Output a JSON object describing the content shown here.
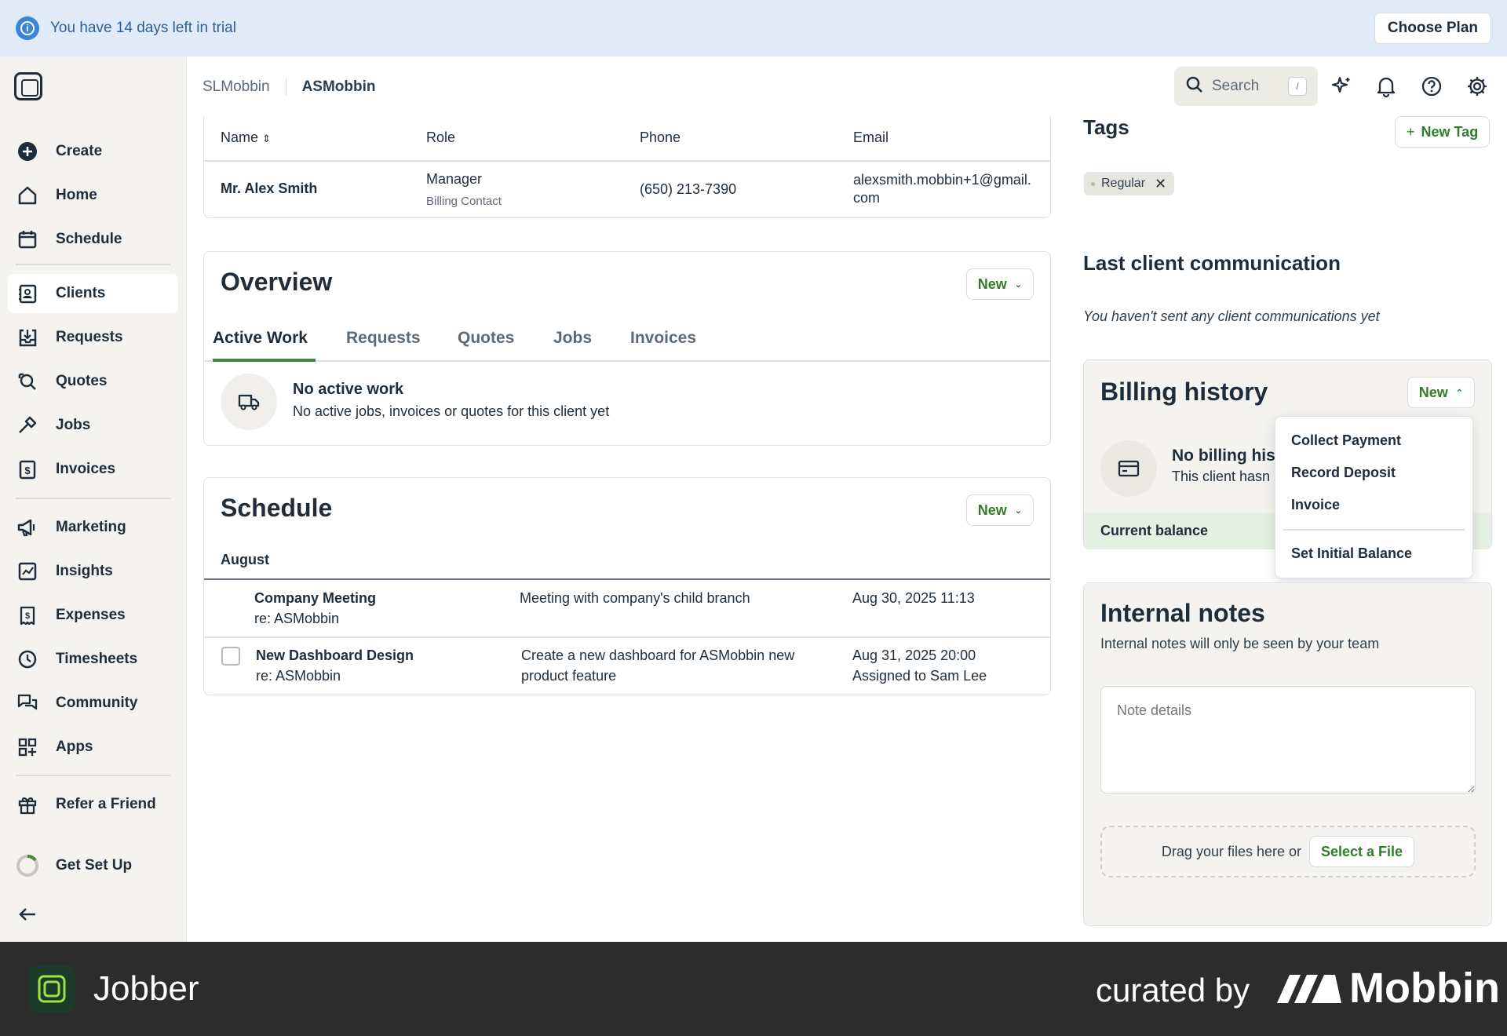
{
  "banner": {
    "text": "You have 14 days left in trial",
    "choose_plan": "Choose Plan"
  },
  "sidebar": {
    "items": [
      {
        "label": "Create"
      },
      {
        "label": "Home"
      },
      {
        "label": "Schedule"
      },
      {
        "label": "Clients"
      },
      {
        "label": "Requests"
      },
      {
        "label": "Quotes"
      },
      {
        "label": "Jobs"
      },
      {
        "label": "Invoices"
      },
      {
        "label": "Marketing"
      },
      {
        "label": "Insights"
      },
      {
        "label": "Expenses"
      },
      {
        "label": "Timesheets"
      },
      {
        "label": "Community"
      },
      {
        "label": "Apps"
      },
      {
        "label": "Refer a Friend"
      },
      {
        "label": "Get Set Up"
      }
    ]
  },
  "header": {
    "breadcrumb": [
      "SLMobbin",
      "ASMobbin"
    ],
    "search_placeholder": "Search",
    "search_shortcut": "/"
  },
  "contacts": {
    "columns": [
      "Name",
      "Role",
      "Phone",
      "Email"
    ],
    "row": {
      "name": "Mr. Alex Smith",
      "role": "Manager",
      "role_sub": "Billing Contact",
      "phone": "(650) 213-7390",
      "email_line1": "alexsmith.mobbin+1@gmail.",
      "email_line2": "com"
    }
  },
  "overview": {
    "title": "Overview",
    "new_label": "New",
    "tabs": [
      "Active Work",
      "Requests",
      "Quotes",
      "Jobs",
      "Invoices"
    ],
    "empty_title": "No active work",
    "empty_text": "No active jobs, invoices or quotes for this client yet"
  },
  "schedule": {
    "title": "Schedule",
    "new_label": "New",
    "month": "August",
    "rows": [
      {
        "title": "Company Meeting",
        "re": "re: ASMobbin",
        "desc": "Meeting with company's child branch",
        "desc2": "",
        "when": "Aug 30, 2025 11:13",
        "assigned": ""
      },
      {
        "title": "New Dashboard Design",
        "re": "re: ASMobbin",
        "desc": "Create a new dashboard for ASMobbin new",
        "desc2": "product feature",
        "when": "Aug 31, 2025 20:00",
        "assigned": "Assigned to Sam Lee"
      }
    ]
  },
  "tags": {
    "title": "Tags",
    "new_tag": "New Tag",
    "chips": [
      "Regular"
    ]
  },
  "last_comm": {
    "title": "Last client communication",
    "text": "You haven't sent any client communications yet"
  },
  "billing": {
    "title": "Billing history",
    "new_label": "New",
    "empty_title": "No billing hist",
    "empty_text": "This client hasn",
    "balance_label": "Current balance"
  },
  "dropdown": {
    "options": [
      "Collect Payment",
      "Record Deposit",
      "Invoice",
      "Set Initial Balance"
    ]
  },
  "notes": {
    "title": "Internal notes",
    "subtitle": "Internal notes will only be seen by your team",
    "placeholder": "Note details",
    "drop_text": "Drag your files here or",
    "select_file": "Select a File"
  },
  "footer": {
    "app_name": "Jobber",
    "curated": "curated by",
    "brand": "Mobbin"
  },
  "colors": {
    "brand_green": "#3f8a3a",
    "banner_bg": "#e1ebf7",
    "sidebar_bg": "#f4f3ef",
    "footer_bg": "#2c2c2c"
  }
}
